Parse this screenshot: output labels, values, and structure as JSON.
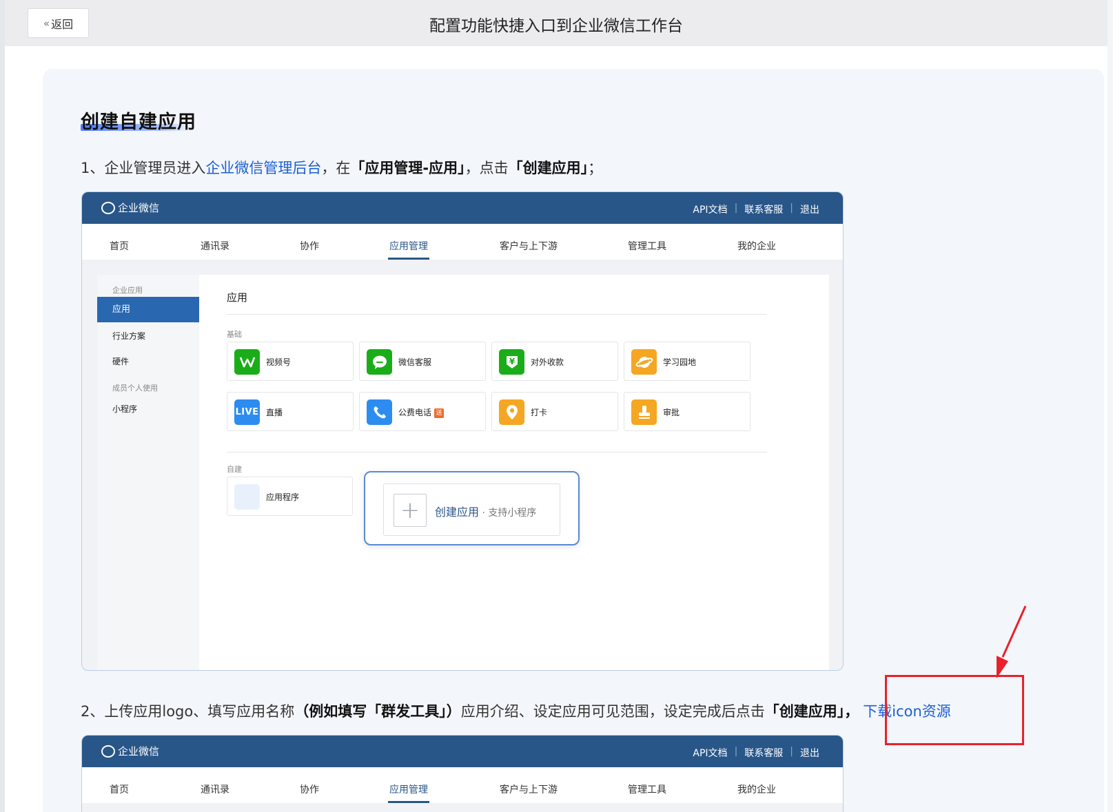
{
  "header": {
    "back_label": "返回",
    "title": "配置功能快捷入口到企业微信工作台"
  },
  "section": {
    "title": "创建自建应用"
  },
  "step1": {
    "prefix": "1、企业管理员进入",
    "link": "企业微信管理后台",
    "mid": "，在",
    "bold1": "「应用管理-应用」",
    "mid2": "，点击",
    "bold2": "「创建应用」",
    "suffix": "；"
  },
  "step2": {
    "prefix": "2、上传应用logo、填写应用名称",
    "bold1": "（例如填写「群发工具」）",
    "mid": "应用介绍、设定应用可见范围，设定完成后点击",
    "bold2": "「创建应用」",
    "sep": "，",
    "link": "下载icon资源"
  },
  "mock": {
    "logo_text": "企业微信",
    "links": [
      "API文档",
      "联系客服",
      "退出"
    ],
    "nav": [
      "首页",
      "通讯录",
      "协作",
      "应用管理",
      "客户与上下游",
      "管理工具",
      "我的企业"
    ],
    "sidebar": {
      "group1": "企业应用",
      "active_item": "应用",
      "item_industry": "行业方案",
      "item_hardware": "硬件",
      "group2": "成员个人使用",
      "item_miniapp": "小程序"
    },
    "content_title": "应用",
    "group_basic": "基础",
    "apps": [
      {
        "name": "视频号",
        "icon": "channels-icon",
        "color": "#1aad19",
        "glyph": "W"
      },
      {
        "name": "微信客服",
        "icon": "wechat-service-icon",
        "color": "#1aad19",
        "glyph": "●"
      },
      {
        "name": "对外收款",
        "icon": "payment-icon",
        "color": "#1aad19",
        "glyph": "¥"
      },
      {
        "name": "学习园地",
        "icon": "learning-icon",
        "color": "#f5a623",
        "glyph": "◐"
      },
      {
        "name": "直播",
        "icon": "live-icon",
        "color": "#2d8cf0",
        "glyph": "LIVE"
      },
      {
        "name": "公费电话",
        "icon": "phone-icon",
        "color": "#2d8cf0",
        "glyph": "✆"
      },
      {
        "name": "打卡",
        "icon": "checkin-icon",
        "color": "#f5a623",
        "glyph": "●"
      },
      {
        "name": "审批",
        "icon": "approval-icon",
        "color": "#f5a623",
        "glyph": "♟"
      }
    ],
    "phone_badge": "送",
    "group_custom": "自建",
    "custom_app_name": "应用程序",
    "create_label": "创建应用",
    "create_sub": " · 支持小程序"
  }
}
